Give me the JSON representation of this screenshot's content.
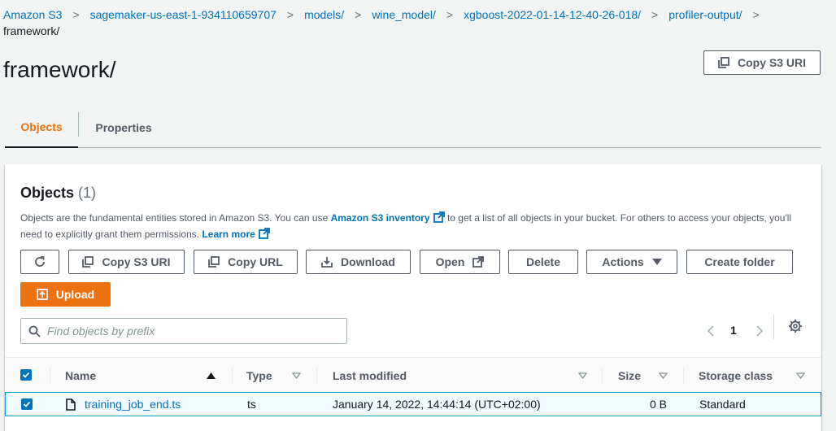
{
  "breadcrumb": {
    "items": [
      "Amazon S3",
      "sagemaker-us-east-1-934110659707",
      "models/",
      "wine_model/",
      "xgboost-2022-01-14-12-40-26-018/",
      "profiler-output/"
    ],
    "current": "framework/"
  },
  "page": {
    "title": "framework/",
    "copy_uri_label": "Copy S3 URI"
  },
  "tabs": [
    {
      "label": "Objects",
      "active": true
    },
    {
      "label": "Properties",
      "active": false
    }
  ],
  "objects_panel": {
    "title": "Objects",
    "count": "(1)",
    "desc_part1": "Objects are the fundamental entities stored in Amazon S3. You can use ",
    "desc_link1": "Amazon S3 inventory",
    "desc_part2": " to get a list of all objects in your bucket. For others to access your objects, you'll need to explicitly grant them permissions. ",
    "desc_link2": "Learn more",
    "toolbar": {
      "copy_s3_uri": "Copy S3 URI",
      "copy_url": "Copy URL",
      "download": "Download",
      "open": "Open",
      "delete": "Delete",
      "actions": "Actions",
      "create_folder": "Create folder",
      "upload": "Upload"
    },
    "search": {
      "placeholder": "Find objects by prefix",
      "value": ""
    },
    "pagination": {
      "page": "1"
    }
  },
  "table": {
    "columns": [
      "Name",
      "Type",
      "Last modified",
      "Size",
      "Storage class"
    ],
    "rows": [
      {
        "name": "training_job_end.ts",
        "type": "ts",
        "last_modified": "January 14, 2022, 14:44:14 (UTC+02:00)",
        "size": "0 B",
        "storage_class": "Standard",
        "selected": true
      }
    ]
  },
  "colors": {
    "accent": "#ec7211",
    "link": "#0073bb",
    "selected_row": "#f1faff"
  }
}
